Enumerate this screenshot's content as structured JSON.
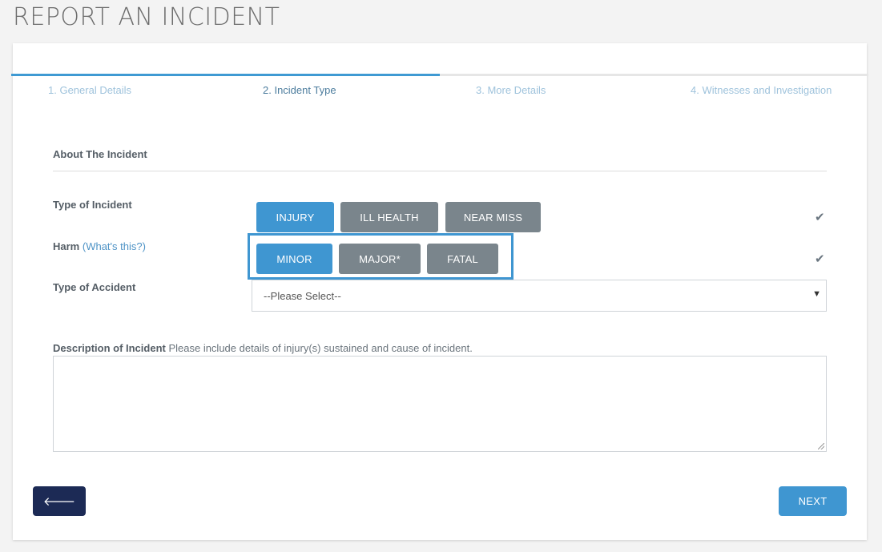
{
  "page": {
    "title": "REPORT AN INCIDENT"
  },
  "progress": {
    "completed_fraction": 0.5,
    "steps": [
      {
        "label": "1. General Details",
        "state": "done"
      },
      {
        "label": "2. Incident Type",
        "state": "active"
      },
      {
        "label": "3. More Details",
        "state": "pending"
      },
      {
        "label": "4. Witnesses and Investigation",
        "state": "pending"
      }
    ]
  },
  "section": {
    "title": "About The Incident"
  },
  "incident_type": {
    "label": "Type of Incident",
    "options": [
      "INJURY",
      "ILL HEALTH",
      "NEAR MISS"
    ],
    "selected": "INJURY",
    "check_icon": "check-icon"
  },
  "harm": {
    "label": "Harm",
    "help_link": "(What's this?)",
    "options": [
      "MINOR",
      "MAJOR*",
      "FATAL"
    ],
    "selected": "MINOR",
    "check_icon": "check-icon"
  },
  "accident_type": {
    "label": "Type of Accident",
    "selected_value": "--Please Select--",
    "caret_icon": "caret-down-icon"
  },
  "description": {
    "label_bold": "Description of Incident",
    "label_hint": " Please include details of injury(s) sustained and cause of incident.",
    "value": ""
  },
  "footer": {
    "back_icon": "arrow-left-icon",
    "back_glyph": "🡐",
    "next_label": "NEXT"
  },
  "colors": {
    "accent": "#3f96d1",
    "button_unselected": "#7a858c",
    "back_button": "#1c2a55",
    "step_active": "#4d7d9e",
    "step_inactive": "#9fc3dc"
  }
}
